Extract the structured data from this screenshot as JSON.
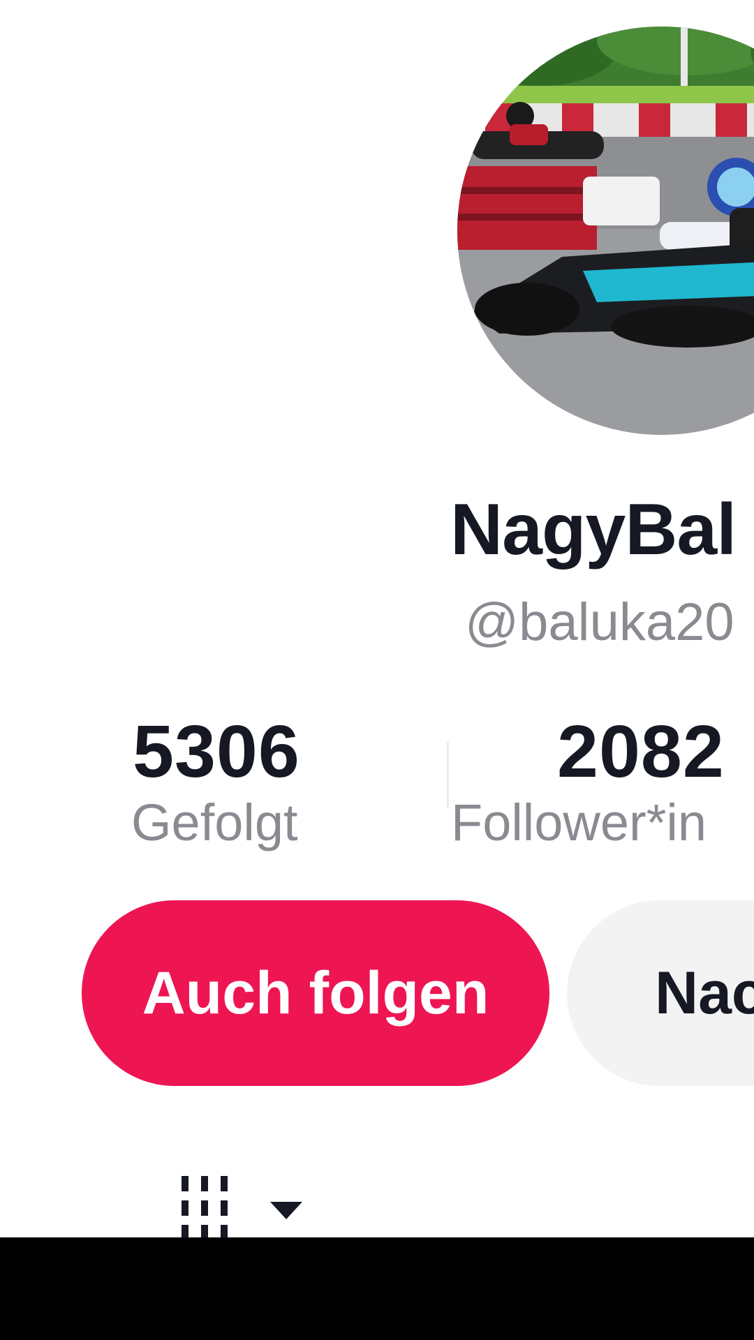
{
  "profile": {
    "display_name": "NagyBal",
    "username": "@baluka20"
  },
  "stats": {
    "following": {
      "value": "5306",
      "label": "Gefolgt"
    },
    "followers": {
      "value": "2082",
      "label": "Follower*in"
    }
  },
  "actions": {
    "follow_back_label": "Auch folgen",
    "message_label": "Nac"
  },
  "icons": {
    "grid_toggle": "grid-view-icon",
    "dropdown": "caret-down-icon"
  },
  "colors": {
    "follow_button": "#ee1553",
    "message_button": "#f3f3f4",
    "secondary_text": "#8a8b91",
    "primary_text": "#161823"
  }
}
